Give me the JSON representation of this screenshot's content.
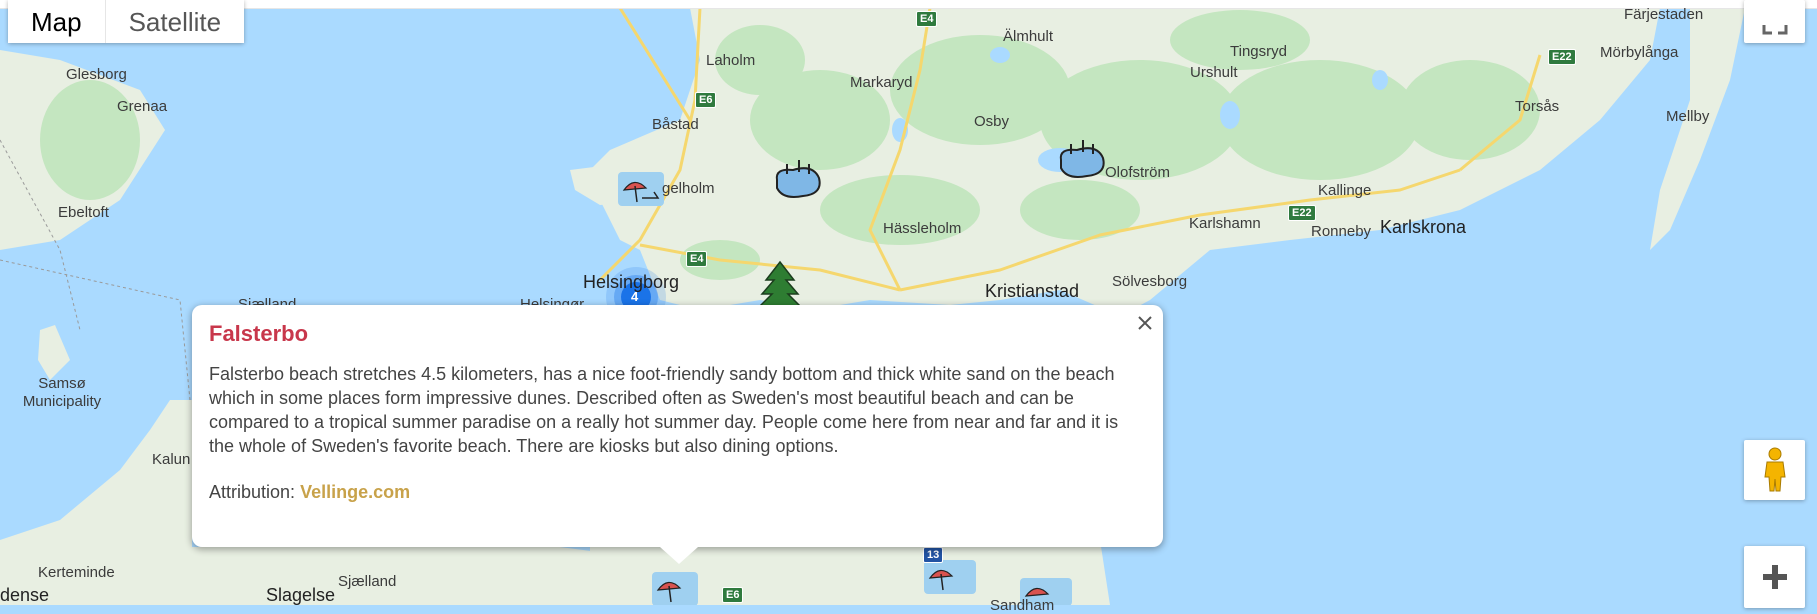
{
  "map_type": {
    "map_label": "Map",
    "satellite_label": "Satellite"
  },
  "places": {
    "farjestaden": "Färjestaden",
    "almhult": "Älmhult",
    "laholm": "Laholm",
    "glesborg": "Glesborg",
    "tingsryd": "Tingsryd",
    "morbylanga": "Mörbylånga",
    "grenaa": "Grenaa",
    "urshult": "Urshult",
    "markaryd": "Markaryd",
    "bastad": "Båstad",
    "osby": "Osby",
    "torsas": "Torsås",
    "mellby": "Mellby",
    "angelholm": "gelholm",
    "olofstrom": "Olofström",
    "ebeltoft": "Ebeltoft",
    "kallinge": "Kallinge",
    "karlshamn": "Karlshamn",
    "ronneby": "Ronneby",
    "karlskrona": "Karlskrona",
    "hassleholm": "Hässleholm",
    "helsingborg": "Helsingborg",
    "helsingor": "Helsingør",
    "kristianstad": "Kristianstad",
    "solvesborg": "Sölvesborg",
    "sjaelland_nord": "Sjælland",
    "samso": "Samsø Municipality",
    "kalundborg": "Kalun",
    "kerteminde": "Kerteminde",
    "sjaelland": "Sjælland",
    "slagelse": "Slagelse",
    "odense": "dense",
    "sandhammaren": "Sandham"
  },
  "road_badges": {
    "e4_top": "E4",
    "e6_bastad": "E6",
    "e4_helsingborg": "E4",
    "e22_east": "E22",
    "e22_kallinge": "E22",
    "e6_south": "E6",
    "r13": "13"
  },
  "cluster": {
    "count": "4"
  },
  "popup": {
    "title": "Falsterbo",
    "description": "Falsterbo beach stretches 4.5 kilometers, has a nice foot-friendly sandy bottom and thick white sand on the beach which in some places form impressive dunes. Described often as Sweden's most beautiful beach and can be compared to a tropical summer paradise on a really hot summer day. People come here from near and far and it is the whole of Sweden's favorite beach. There are kiosks but also dining options.",
    "attribution_label": "Attribution:",
    "attribution_link": "Vellinge.com"
  },
  "icons": {
    "beach": "beach-umbrella-icon",
    "lake": "lake-icon",
    "forest": "pine-tree-icon",
    "close": "close-icon",
    "fullscreen": "fullscreen-icon",
    "pegman": "pegman-icon",
    "zoom_in": "plus-icon"
  },
  "colors": {
    "water": "#aadaff",
    "land": "#e8efe2",
    "forest": "#c4e6c0",
    "title": "#c8374b",
    "link": "#c8a24a",
    "cluster": "#1a73e8"
  }
}
